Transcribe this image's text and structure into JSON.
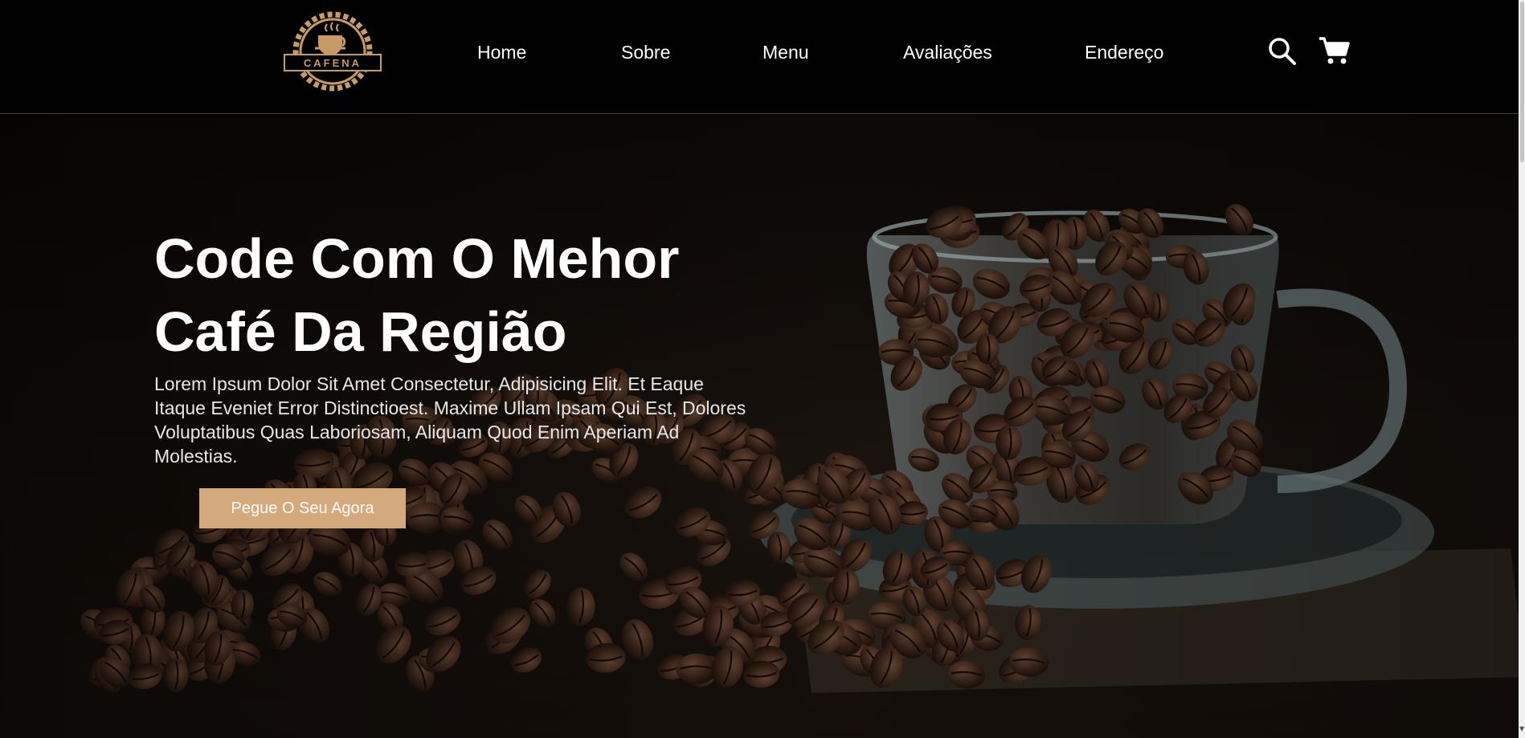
{
  "logo": {
    "text": "CAFENA",
    "icon": "coffee-cup-logo-icon"
  },
  "nav": {
    "items": [
      {
        "label": "Home"
      },
      {
        "label": "Sobre"
      },
      {
        "label": "Menu"
      },
      {
        "label": "Avaliações"
      },
      {
        "label": "Endereço"
      }
    ]
  },
  "header_icons": {
    "search": "search-icon",
    "cart": "cart-icon"
  },
  "hero": {
    "title_line1": "Code Com O Mehor",
    "title_line2": "Café Da Região",
    "description": "Lorem Ipsum Dolor Sit Amet Consectetur, Adipisicing Elit. Et Eaque Itaque Eveniet Error Distinctioest. Maxime Ullam Ipsam Qui Est, Dolores Voluptatibus Quas Laboriosam, Aliquam Quod Enim Aperiam Ad Molestias.",
    "button_label": "Pegue O Seu Agora"
  },
  "colors": {
    "accent": "#d4a97c",
    "header_bg": "#000000",
    "header_border": "#4a4a22"
  }
}
